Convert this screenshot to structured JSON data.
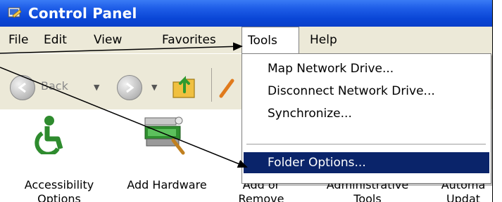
{
  "window": {
    "title": "Control Panel"
  },
  "menubar": {
    "items": [
      {
        "label": "File"
      },
      {
        "label": "Edit"
      },
      {
        "label": "View"
      },
      {
        "label": "Favorites"
      },
      {
        "label": "Tools"
      },
      {
        "label": "Help"
      }
    ]
  },
  "toolbar": {
    "back_label": "Back"
  },
  "tools_menu": {
    "items": [
      {
        "label": "Map Network Drive..."
      },
      {
        "label": "Disconnect Network Drive..."
      },
      {
        "label": "Synchronize..."
      },
      {
        "label": "Folder Options..."
      }
    ],
    "selected": "Folder Options..."
  },
  "content": {
    "items": [
      {
        "label": "Accessibility Options"
      },
      {
        "label": "Add Hardware"
      },
      {
        "label": "Add or Remove"
      },
      {
        "label": "Administrative Tools"
      },
      {
        "label": "Automa Updat"
      }
    ]
  },
  "colors": {
    "titlebar": "#0a46d6",
    "menu_face": "#ece9d8",
    "selection": "#0a246a"
  }
}
